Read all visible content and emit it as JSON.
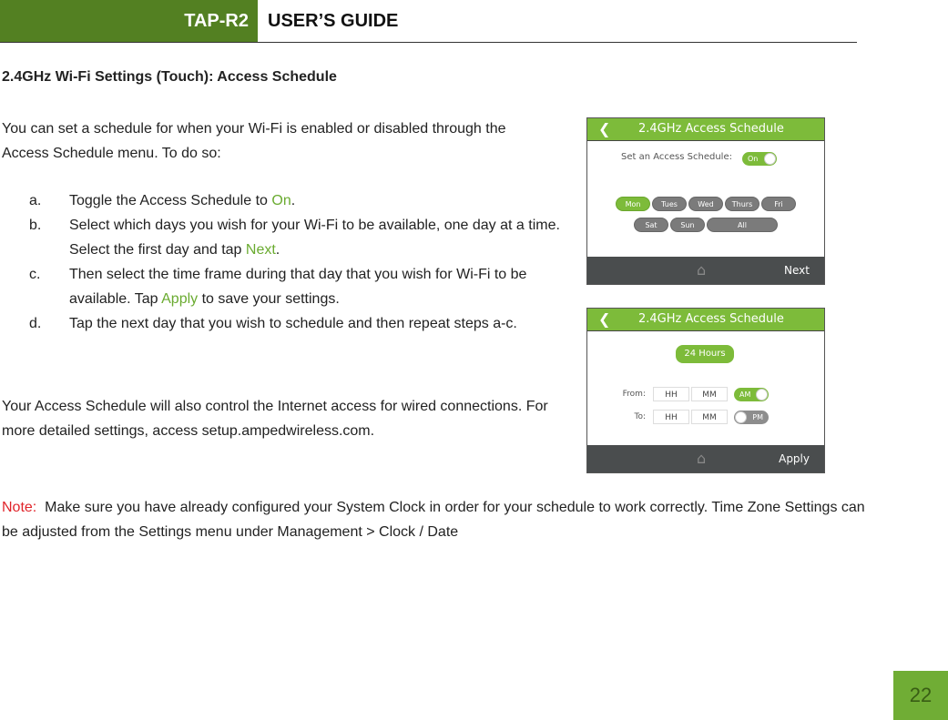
{
  "header": {
    "product": "TAP-R2",
    "guide": "USER’S GUIDE"
  },
  "section_title": "2.4GHz Wi-Fi Settings (Touch): Access Schedule",
  "intro": "You can set a schedule for when your Wi-Fi is enabled or disabled through the Access Schedule menu. To do so:",
  "steps": [
    {
      "marker": "a.",
      "pre": "Toggle the Access Schedule to ",
      "highlight": "On",
      "post": "."
    },
    {
      "marker": "b.",
      "pre": "Select which days you wish for your Wi-Fi to be available, one day at a time. Select the first day and tap ",
      "highlight": "Next",
      "post": "."
    },
    {
      "marker": "c.",
      "pre": "Then select the time frame during that day that you wish for Wi-Fi to be available. Tap ",
      "highlight": "Apply",
      "post": " to save your settings."
    },
    {
      "marker": "d.",
      "pre": "Tap the next day that you wish to schedule and then repeat steps a-c.",
      "highlight": "",
      "post": ""
    }
  ],
  "extra": "Your Access Schedule will also control the Internet access for wired connections. For more detailed settings, access setup.ampedwireless.com.",
  "note": {
    "label": "Note:",
    "text": "  Make sure you have already configured your System Clock in order for your schedule to work correctly. Time Zone Settings can be adjusted from the Settings menu under Management > Clock / Date"
  },
  "page_number": "22",
  "screen1": {
    "back_icon": "chevron-left-icon",
    "title": "2.4GHz Access Schedule",
    "schedule_label": "Set an Access Schedule:",
    "toggle_label": "On",
    "toggle_on": true,
    "days_row1": [
      {
        "label": "Mon",
        "active": true
      },
      {
        "label": "Tues",
        "active": false
      },
      {
        "label": "Wed",
        "active": false
      },
      {
        "label": "Thurs",
        "active": false
      },
      {
        "label": "Fri",
        "active": false
      }
    ],
    "days_row2": [
      {
        "label": "Sat",
        "active": false
      },
      {
        "label": "Sun",
        "active": false
      },
      {
        "label": "All",
        "active": false
      }
    ],
    "home_icon": "home-icon",
    "action": "Next"
  },
  "screen2": {
    "back_icon": "chevron-left-icon",
    "title": "2.4GHz Access Schedule",
    "hours_button": "24 Hours",
    "from_label": "From:",
    "to_label": "To:",
    "hh_placeholder": "HH",
    "mm_placeholder": "MM",
    "from_toggle": "AM",
    "to_toggle": "PM",
    "home_icon": "home-icon",
    "action": "Apply"
  }
}
